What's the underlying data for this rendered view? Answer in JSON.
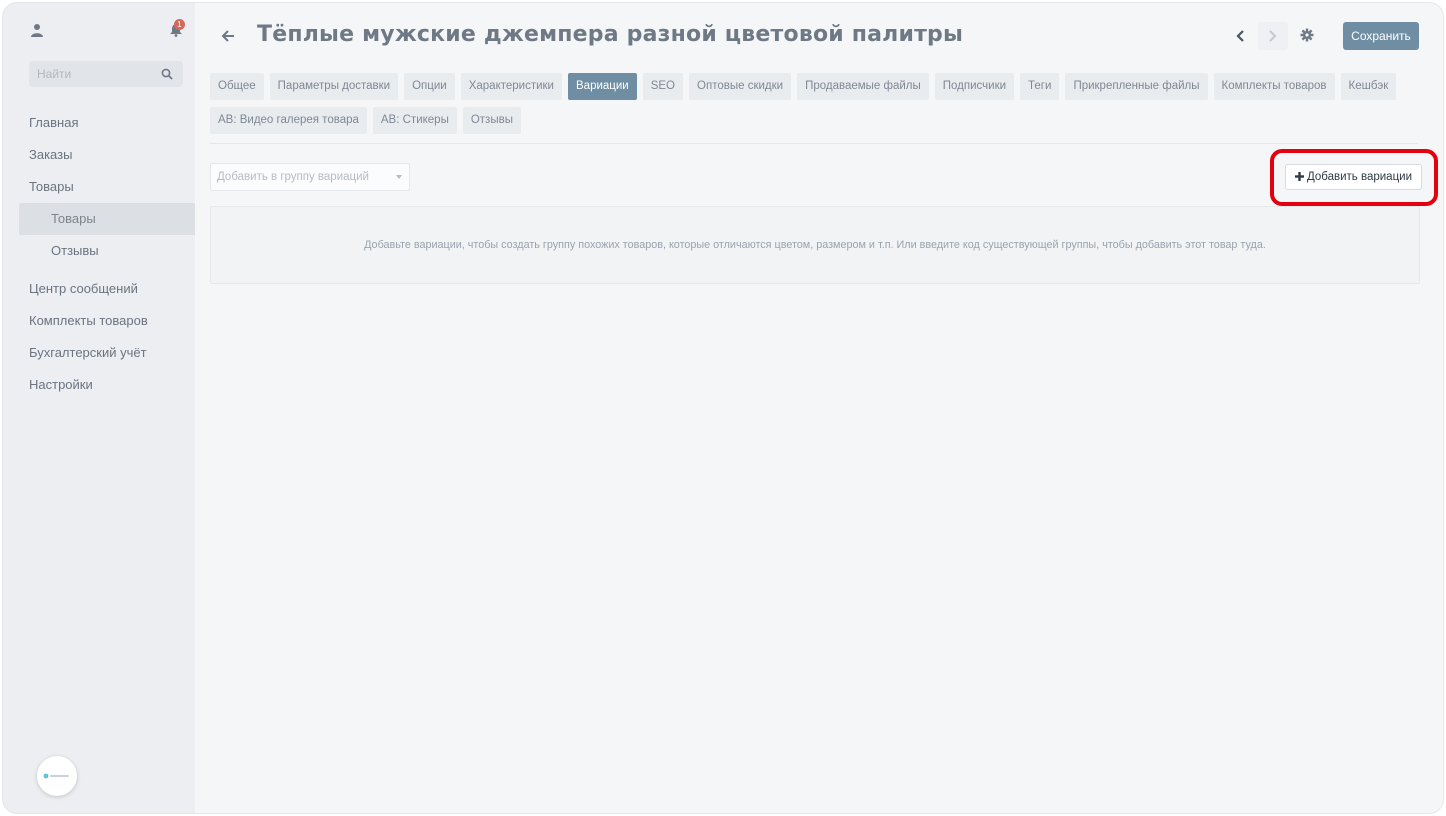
{
  "sidebar": {
    "badge": "1",
    "search": {
      "placeholder": "Найти"
    },
    "items": [
      {
        "label": "Главная"
      },
      {
        "label": "Заказы"
      },
      {
        "label": "Товары"
      },
      {
        "label": "Товары"
      },
      {
        "label": "Отзывы"
      },
      {
        "label": "Центр сообщений"
      },
      {
        "label": "Комплекты товаров"
      },
      {
        "label": "Бухгалтерский учёт"
      },
      {
        "label": "Настройки"
      }
    ]
  },
  "header": {
    "title": "Тёплые мужские джемпера разной цветовой палитры",
    "save_label": "Сохранить"
  },
  "tabs": [
    {
      "label": "Общее"
    },
    {
      "label": "Параметры доставки"
    },
    {
      "label": "Опции"
    },
    {
      "label": "Характеристики"
    },
    {
      "label": "Вариации"
    },
    {
      "label": "SEO"
    },
    {
      "label": "Оптовые скидки"
    },
    {
      "label": "Продаваемые файлы"
    },
    {
      "label": "Подписчики"
    },
    {
      "label": "Теги"
    },
    {
      "label": "Прикрепленные файлы"
    },
    {
      "label": "Комплекты товаров"
    },
    {
      "label": "Кешбэк"
    },
    {
      "label": "AB: Видео галерея товара"
    },
    {
      "label": "AB: Стикеры"
    },
    {
      "label": "Отзывы"
    }
  ],
  "active_tab": "Вариации",
  "variations": {
    "group_select_placeholder": "Добавить в группу вариаций",
    "add_button": "Добавить вариации",
    "empty_text": "Добавьте вариации, чтобы создать группу похожих товаров, которые отличаются цветом, размером и т.п. Или введите код существующей группы, чтобы добавить этот товар туда."
  },
  "colors": {
    "accent": "#6f8ea4",
    "highlight": "#e3000f",
    "badge": "#d26a5c"
  }
}
